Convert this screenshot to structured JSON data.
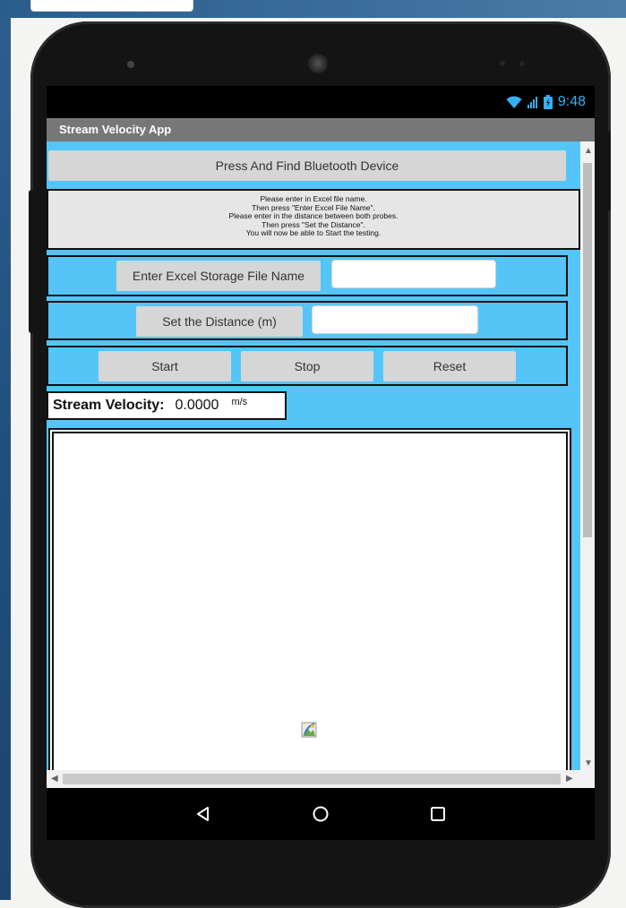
{
  "status_bar": {
    "time": "9:48"
  },
  "app": {
    "title": "Stream Velocity App"
  },
  "buttons": {
    "find_bluetooth": "Press And Find Bluetooth Device",
    "enter_excel": "Enter Excel Storage File Name",
    "set_distance": "Set the Distance (m)",
    "start": "Start",
    "stop": "Stop",
    "reset": "Reset"
  },
  "instructions": [
    "Please enter in Excel file name.",
    "Then press \"Enter Excel File Name\".",
    "Please enter in the distance between both probes.",
    "Then press \"Set the Distance\".",
    "You will now be able to Start the testing."
  ],
  "inputs": {
    "excel_file_name": "",
    "distance": ""
  },
  "velocity": {
    "label": "Stream Velocity:",
    "value": "0.0000",
    "unit": "m/s"
  },
  "icons": {
    "wifi": "wifi-icon",
    "signal": "cell-signal-icon",
    "battery": "battery-icon",
    "back": "back-icon",
    "home": "home-icon",
    "recents": "recents-icon",
    "image_placeholder": "image-placeholder-icon"
  },
  "colors": {
    "content_bg": "#55c5f8",
    "title_bar": "#777777",
    "status_icons": "#35b0f4"
  }
}
